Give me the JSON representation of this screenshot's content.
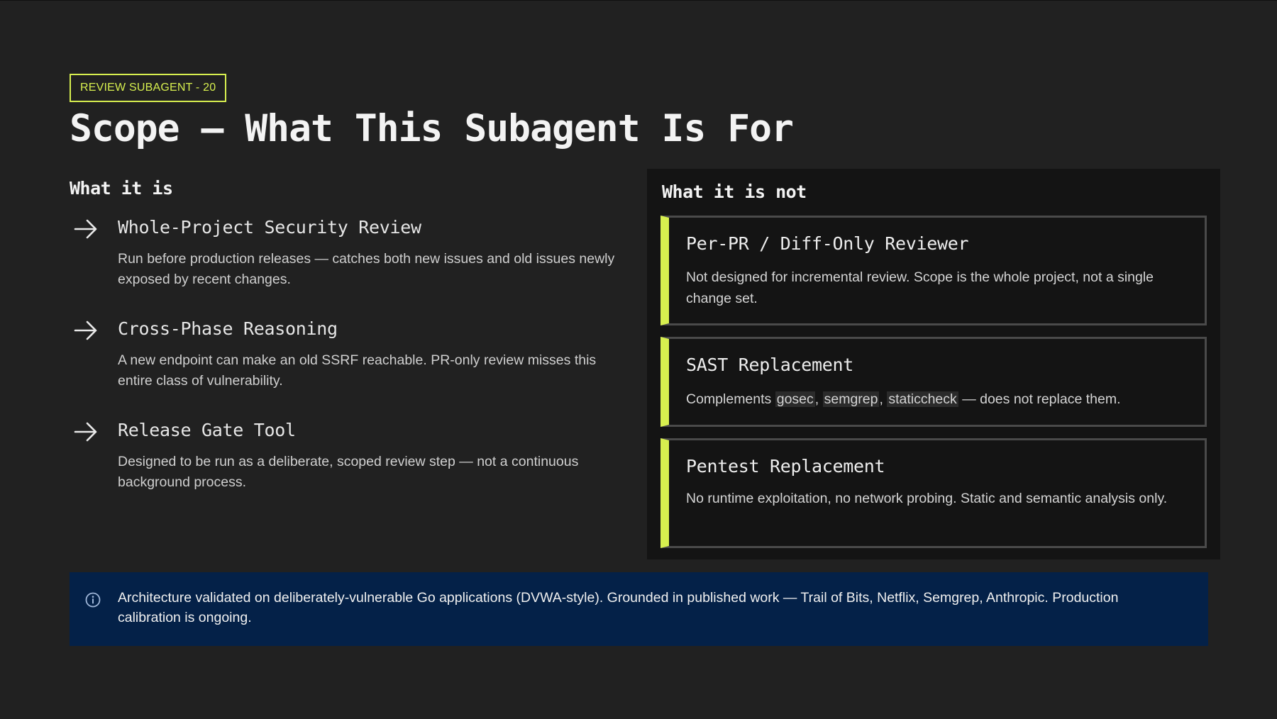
{
  "badge": "REVIEW SUBAGENT - 20",
  "title": "Scope — What This Subagent Is For",
  "left": {
    "heading": "What it is",
    "items": [
      {
        "title": "Whole-Project Security Review",
        "desc": "Run before production releases — catches both new issues and old issues newly exposed by recent changes."
      },
      {
        "title": "Cross-Phase Reasoning",
        "desc": "A new endpoint can make an old SSRF reachable. PR-only review misses this entire class of vulnerability."
      },
      {
        "title": "Release Gate Tool",
        "desc": "Designed to be run as a deliberate, scoped review step — not a continuous background process."
      }
    ]
  },
  "right": {
    "heading": "What it is not",
    "cards": [
      {
        "title": "Per-PR / Diff-Only Reviewer",
        "desc": "Not designed for incremental review. Scope is the whole project, not a single change set."
      },
      {
        "title": "SAST Replacement",
        "desc_prefix": "Complements ",
        "code1": "gosec",
        "sep1": ", ",
        "code2": "semgrep",
        "sep2": ", ",
        "code3": "staticcheck",
        "desc_suffix": " — does not replace them."
      },
      {
        "title": "Pentest Replacement",
        "desc": "No runtime exploitation, no network probing. Static and semantic analysis only."
      }
    ]
  },
  "info": {
    "icon": "info-icon",
    "text": "Architecture validated on deliberately-vulnerable Go applications (DVWA-style). Grounded in published work — Trail of Bits, Netflix, Semgrep, Anthropic. Production calibration is ongoing."
  },
  "colors": {
    "background": "#212121",
    "accent": "#d7ef4f",
    "panel": "#141414",
    "info_bg": "#042148"
  }
}
